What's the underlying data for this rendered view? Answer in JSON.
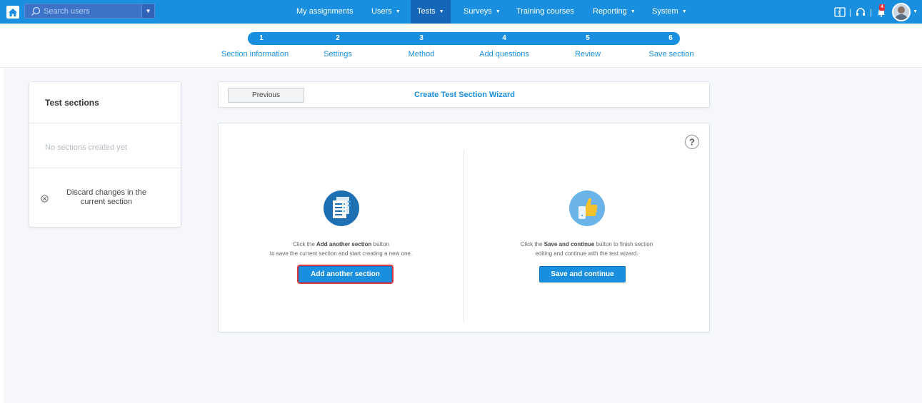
{
  "topnav": {
    "search_placeholder": "Search users",
    "items": [
      {
        "label": "My assignments",
        "dropdown": false
      },
      {
        "label": "Users",
        "dropdown": true
      },
      {
        "label": "Tests",
        "dropdown": true,
        "active": true
      },
      {
        "label": "Surveys",
        "dropdown": true
      },
      {
        "label": "Training courses",
        "dropdown": false
      },
      {
        "label": "Reporting",
        "dropdown": true
      },
      {
        "label": "System",
        "dropdown": true
      }
    ],
    "notification_count": "4",
    "icons": [
      "home-icon",
      "search-icon",
      "book-icon",
      "headset-icon",
      "notification-bell-icon",
      "avatar"
    ]
  },
  "stepper": {
    "steps": [
      {
        "number": "1",
        "label": "Section information"
      },
      {
        "number": "2",
        "label": "Settings"
      },
      {
        "number": "3",
        "label": "Method"
      },
      {
        "number": "4",
        "label": "Add questions"
      },
      {
        "number": "5",
        "label": "Review"
      },
      {
        "number": "6",
        "label": "Save section"
      }
    ]
  },
  "sidebar": {
    "title": "Test sections",
    "empty_text": "No sections created yet",
    "discard_label": "Discard changes in the current section"
  },
  "wizard": {
    "previous_label": "Previous",
    "title": "Create Test Section Wizard"
  },
  "main": {
    "left": {
      "desc_prefix": "Click the ",
      "desc_bold": "Add another section",
      "desc_suffix": " button",
      "desc_line2": "to save the current section and start creating a new one.",
      "button_label": "Add another section"
    },
    "right": {
      "desc_prefix": "Click the ",
      "desc_bold": "Save and continue",
      "desc_suffix": " button to finish section",
      "desc_line2": "editing and continue with the test wizard.",
      "button_label": "Save and continue"
    }
  },
  "colors": {
    "primary": "#1a8fe0",
    "nav_active": "#1565b8",
    "highlight_border": "#d9363e",
    "badge": "#e0303a"
  }
}
